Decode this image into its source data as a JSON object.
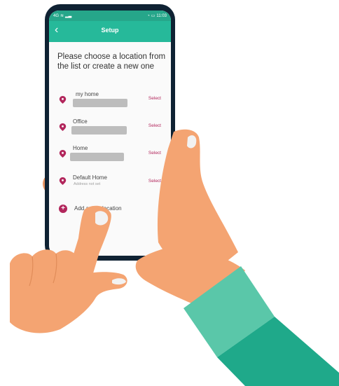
{
  "status_bar": {
    "left_text": "4G",
    "time": "11:03"
  },
  "header": {
    "title": "Setup",
    "back_icon": "chevron-left-icon"
  },
  "instruction": "Please choose a location from the list or create a new one",
  "locations": [
    {
      "name": "my home",
      "address": "",
      "select_label": "Select"
    },
    {
      "name": "Office",
      "address": "",
      "select_label": "Select"
    },
    {
      "name": "Home",
      "address": "",
      "select_label": "Select"
    },
    {
      "name": "Default Home",
      "address": "Address not set",
      "select_label": "Select"
    }
  ],
  "add_location": {
    "label": "Add a new location",
    "icon": "plus-circle-icon"
  },
  "colors": {
    "accent_green": "#26b99a",
    "accent_pink": "#b2265c",
    "phone_frame": "#0f2233",
    "skin": "#f4a472",
    "sleeve": "#1fa98a"
  }
}
